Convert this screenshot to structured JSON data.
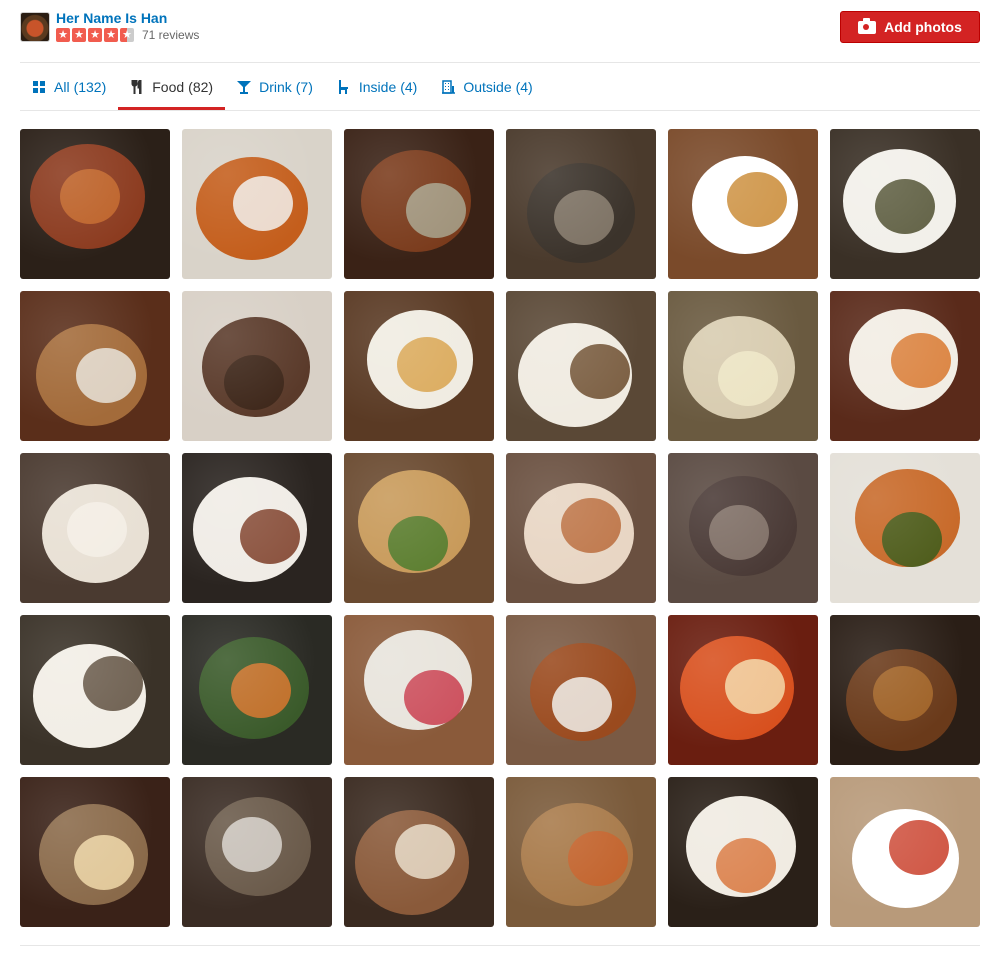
{
  "business": {
    "name": "Her Name Is Han",
    "rating": 4.5,
    "reviews": "71 reviews"
  },
  "actions": {
    "add_photos": "Add photos"
  },
  "tabs": [
    {
      "label": "All",
      "count": "(132)",
      "icon": "grid-icon",
      "active": false
    },
    {
      "label": "Food",
      "count": "(82)",
      "icon": "fork-knife-icon",
      "active": true
    },
    {
      "label": "Drink",
      "count": "(7)",
      "icon": "cocktail-icon",
      "active": false
    },
    {
      "label": "Inside",
      "count": "(4)",
      "icon": "chair-icon",
      "active": false
    },
    {
      "label": "Outside",
      "count": "(4)",
      "icon": "building-icon",
      "active": false
    }
  ],
  "photos": [
    {
      "bg": "#2b2018",
      "plate": "#8b3a1e",
      "accent": "#c66a2b"
    },
    {
      "bg": "#d9d3c9",
      "plate": "#c45e1c",
      "accent": "#f2f0ec"
    },
    {
      "bg": "#3a2216",
      "plate": "#7a3b1c",
      "accent": "#a8a48d"
    },
    {
      "bg": "#4a3a2c",
      "plate": "#3b332b",
      "accent": "#8b7f70"
    },
    {
      "bg": "#7a4a2a",
      "plate": "#ffffff",
      "accent": "#c8862e"
    },
    {
      "bg": "#3a3026",
      "plate": "#f2f0ea",
      "accent": "#4a4a2a"
    },
    {
      "bg": "#5a2e1a",
      "plate": "#a36b3a",
      "accent": "#e8e2d8"
    },
    {
      "bg": "#d8d0c6",
      "plate": "#5a3a2a",
      "accent": "#3a2418"
    },
    {
      "bg": "#5a3a24",
      "plate": "#f0ece2",
      "accent": "#d8a24a"
    },
    {
      "bg": "#5a4836",
      "plate": "#f0ebe1",
      "accent": "#6a4a2a"
    },
    {
      "bg": "#6a5a40",
      "plate": "#d8ccb0",
      "accent": "#f0e8c8"
    },
    {
      "bg": "#5a2a1a",
      "plate": "#f2ede4",
      "accent": "#d8742a"
    },
    {
      "bg": "#4a3a30",
      "plate": "#e8e0d4",
      "accent": "#f4efe6"
    },
    {
      "bg": "#2a2420",
      "plate": "#f0ece6",
      "accent": "#7a3a22"
    },
    {
      "bg": "#6a4a30",
      "plate": "#c89a5a",
      "accent": "#4a7a2a"
    },
    {
      "bg": "#6a5040",
      "plate": "#e8d6c4",
      "accent": "#b86a3a"
    },
    {
      "bg": "#5a4a42",
      "plate": "#4a3a36",
      "accent": "#8a7a70"
    },
    {
      "bg": "#e4e0d8",
      "plate": "#c86a2a",
      "accent": "#3a5a1a"
    },
    {
      "bg": "#3a3228",
      "plate": "#f2eee6",
      "accent": "#5a4a3a"
    },
    {
      "bg": "#2a2a24",
      "plate": "#3a5a2a",
      "accent": "#d8742a"
    },
    {
      "bg": "#8a5a3a",
      "plate": "#e8e4dc",
      "accent": "#c83a4a"
    },
    {
      "bg": "#7a5a44",
      "plate": "#9a4a1e",
      "accent": "#f0eeea"
    },
    {
      "bg": "#6a1e10",
      "plate": "#d8501e",
      "accent": "#f4d8a8"
    },
    {
      "bg": "#2a1e16",
      "plate": "#6a3a1a",
      "accent": "#a86a2a"
    },
    {
      "bg": "#3a2218",
      "plate": "#8a6a4a",
      "accent": "#f0d8a8"
    },
    {
      "bg": "#3a2c24",
      "plate": "#6a5a4a",
      "accent": "#d8d4cc"
    },
    {
      "bg": "#3a2a20",
      "plate": "#8a5a3a",
      "accent": "#e8dcc8"
    },
    {
      "bg": "#7a5a3a",
      "plate": "#a87a4a",
      "accent": "#c8622a"
    },
    {
      "bg": "#2a2018",
      "plate": "#f0ebe2",
      "accent": "#d8743a"
    },
    {
      "bg": "#b89a7a",
      "plate": "#ffffff",
      "accent": "#c83a24"
    }
  ]
}
